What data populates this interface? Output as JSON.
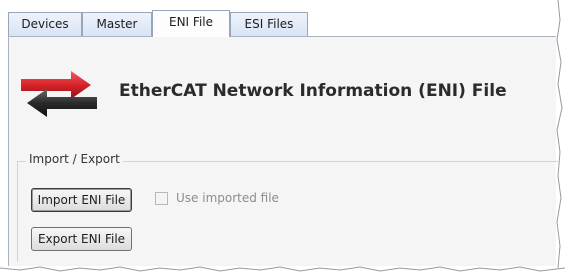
{
  "tabs": [
    {
      "label": "Devices",
      "active": false
    },
    {
      "label": "Master",
      "active": false
    },
    {
      "label": "ENI File",
      "active": true
    },
    {
      "label": "ESI Files",
      "active": false
    }
  ],
  "header": {
    "title": "EtherCAT Network Information (ENI) File",
    "icon": "transfer-arrows-icon"
  },
  "import_export": {
    "group_label": "Import / Export",
    "import_button": "Import ENI File",
    "use_imported_checkbox_label": "Use imported file",
    "use_imported_checked": false,
    "use_imported_enabled": false,
    "export_button": "Export ENI File"
  },
  "colors": {
    "arrow_red": "#d8232a",
    "arrow_dark": "#2a2a2a",
    "tab_bg": "#dbe6f5",
    "panel_bg": "#f5f5f5"
  }
}
